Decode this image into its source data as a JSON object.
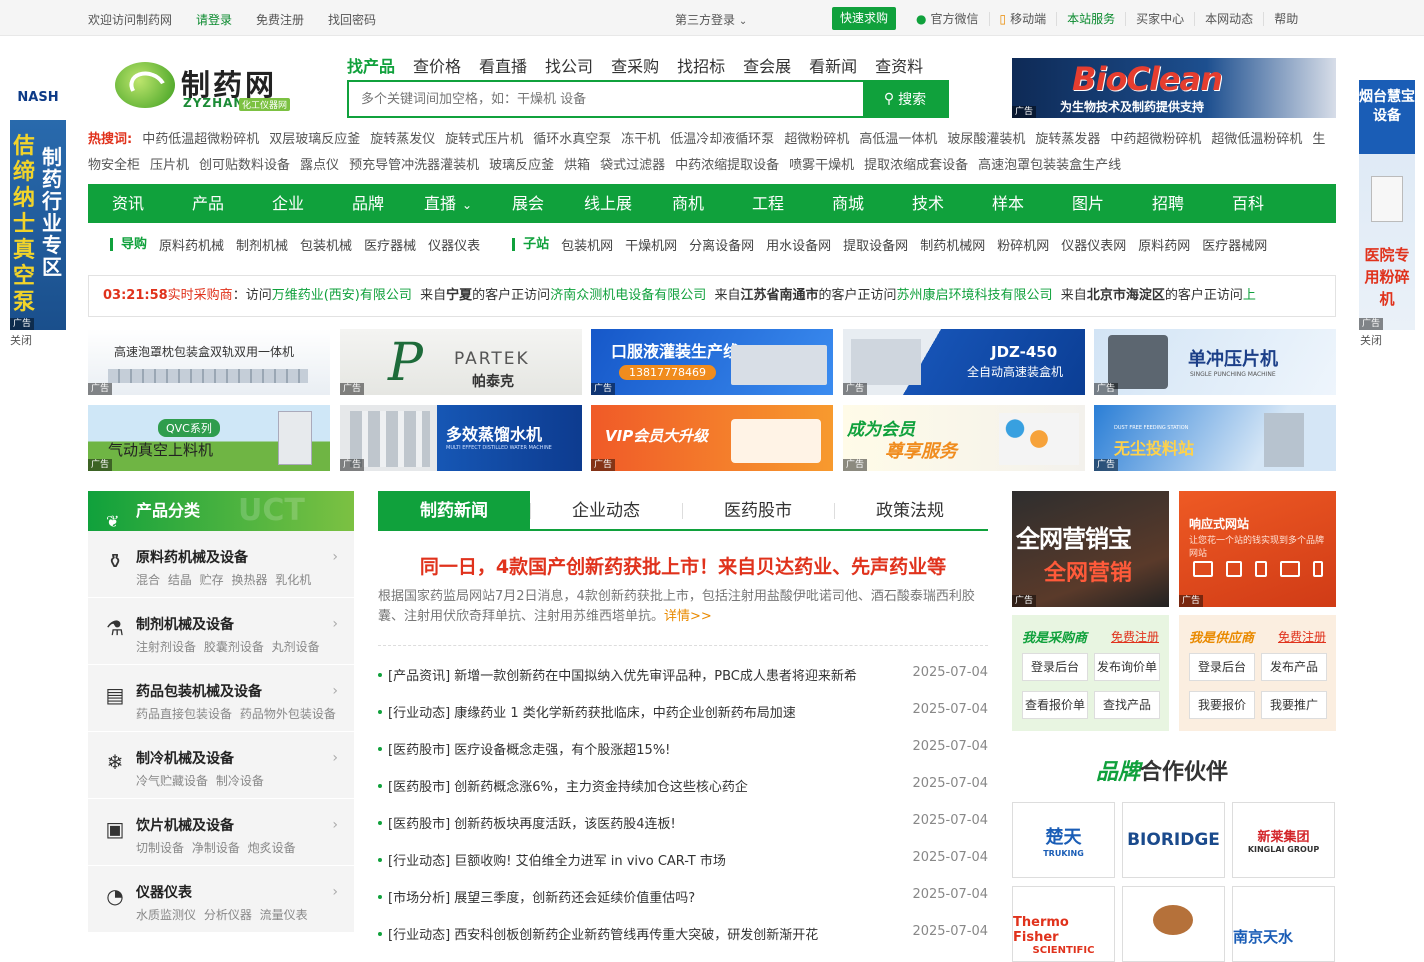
{
  "topbar": {
    "welcome": "欢迎访问制药网",
    "login": "请登录",
    "register": "免费注册",
    "find_password": "找回密码",
    "third_party_login": "第三方登录",
    "quick_purchase": "快速求购",
    "wechat": "官方微信",
    "mobile": "移动端",
    "site_service": "本站服务",
    "buyer_center": "买家中心",
    "site_news": "本网动态",
    "help": "帮助"
  },
  "logo": {
    "name": "制药网",
    "pinyin": "ZYZHAN",
    "tagline": "化工仪器网"
  },
  "search": {
    "tabs": [
      "找产品",
      "查价格",
      "看直播",
      "找公司",
      "查采购",
      "找招标",
      "查会展",
      "看新闻",
      "查资料"
    ],
    "active_tab": 0,
    "placeholder": "多个关键词间加空格，如：干燥机 设备",
    "button": "搜索"
  },
  "top_ad": {
    "brand": "BioClean",
    "text": "为生物技术及制药提供支持",
    "tag": "广告"
  },
  "hotwords": {
    "label": "热搜词:",
    "items": [
      "中药低温超微粉碎机",
      "双层玻璃反应釜",
      "旋转蒸发仪",
      "旋转式压片机",
      "循环水真空泵",
      "冻干机",
      "低温冷却液循环泵",
      "超微粉碎机",
      "高低温一体机",
      "玻尿酸灌装机",
      "旋转蒸发器",
      "中药超微粉碎机",
      "超微低温粉碎机",
      "生物安全柜",
      "压片机",
      "创可贴数料设备",
      "露点仪",
      "预充导管冲洗器灌装机",
      "玻璃反应釜",
      "烘箱",
      "袋式过滤器",
      "中药浓缩提取设备",
      "喷雾干燥机",
      "提取浓缩成套设备",
      "高速泡罩包装装盒生产线"
    ]
  },
  "mainnav": [
    "资讯",
    "产品",
    "企业",
    "品牌",
    "直播",
    "展会",
    "线上展",
    "商机",
    "工程",
    "商城",
    "技术",
    "样本",
    "图片",
    "招聘",
    "百科"
  ],
  "subnav": {
    "guide_label": "导购",
    "guide_items": [
      "原料药机械",
      "制剂机械",
      "包装机械",
      "医疗器械",
      "仪器仪表"
    ],
    "sub_label": "子站",
    "sub_items": [
      "包装机网",
      "干燥机网",
      "分离设备网",
      "用水设备网",
      "提取设备网",
      "制药机械网",
      "粉碎机网",
      "仪器仪表网",
      "原料药网",
      "医疗器械网"
    ]
  },
  "ticker": {
    "time": "03:21:58",
    "label": "实时采购商",
    "p1": "访问",
    "c1": "万维药业(西安)有限公司",
    "p2": "来自",
    "loc2": "宁夏",
    "p3": "的客户正访问",
    "c2": "济南众测机电设备有限公司",
    "p4": "来自",
    "loc3": "江苏省南通市",
    "p5": "的客户正访问",
    "c3": "苏州康启环境科技有限公司",
    "p6": "来自",
    "loc4": "北京市海淀区",
    "p7": "的客户正访问",
    "c4": "上"
  },
  "banners": [
    {
      "text": "高速泡罩枕包装盒双轨双用一体机",
      "tag": "广告"
    },
    {
      "text": "PARTEK",
      "sub": "帕泰克",
      "tag": "广告"
    },
    {
      "text": "口服液灌装生产线",
      "sub": "13817778469",
      "tag": "广告"
    },
    {
      "text": "JDZ-450",
      "sub": "全自动高速装盒机",
      "tag": "广告"
    },
    {
      "text": "单冲压片机",
      "sub": "SINGLE PUNCHING MACHINE",
      "tag": "广告"
    },
    {
      "text": "QVC系列",
      "sub": "气动真空上料机",
      "tag": "广告"
    },
    {
      "text": "多效蒸馏水机",
      "sub": "MULTI EFFECT DISTILLED WATER MACHINE",
      "tag": "广告"
    },
    {
      "text": "VIP会员大升级",
      "tag": "广告"
    },
    {
      "text": "成为会员",
      "sub": "尊享服务",
      "tag": "广告"
    },
    {
      "text": "无尘投料站",
      "sub": "DUST FREE FEEDING STATION",
      "tag": "广告"
    }
  ],
  "left_ad": {
    "brand": "NASH",
    "col1": "佶缔纳士真空泵",
    "col2": "制药行业专区",
    "tag": "广告",
    "close": "关闭"
  },
  "right_ad": {
    "top": "烟台慧宝设备",
    "bottom": "医院专用粉碎机",
    "tag": "广告",
    "close": "关闭"
  },
  "categories": {
    "title": "产品分类",
    "ghost": "UCT",
    "items": [
      {
        "name": "原料药机械及设备",
        "sub": "混合 结晶 贮存 换热器 乳化机",
        "icon": "bottle-icon"
      },
      {
        "name": "制剂机械及设备",
        "sub": "注射剂设备 胶囊剂设备 丸剂设备",
        "icon": "flask-icon"
      },
      {
        "name": "药品包装机械及设备",
        "sub": "药品直接包装设备 药品物外包装设备",
        "icon": "package-icon"
      },
      {
        "name": "制冷机械及设备",
        "sub": "冷气贮藏设备 制冷设备",
        "icon": "snowflake-icon"
      },
      {
        "name": "饮片机械及设备",
        "sub": "切制设备 净制设备 炮炙设备",
        "icon": "machine-icon"
      },
      {
        "name": "仪器仪表",
        "sub": "水质监测仪 分析仪器 流量仪表",
        "icon": "gauge-icon"
      }
    ]
  },
  "news": {
    "tabs": [
      "制药新闻",
      "企业动态",
      "医药股市",
      "政策法规"
    ],
    "headline": "同一日，4款国产创新药获批上市！来自贝达药业、先声药业等",
    "summary": "根据国家药监局网站7月2日消息，4款创新药获批上市，包括注射用盐酸伊吡诺司他、酒石酸泰瑞西利胶囊、注射用伏欣奇拜单抗、注射用苏维西塔单抗。",
    "more": "详情>>",
    "items": [
      {
        "title": "[产品资讯] 新增一款创新药在中国拟纳入优先审评品种，PBC成人患者将迎来新希",
        "date": "2025-07-04"
      },
      {
        "title": "[行业动态] 康缘药业 1 类化学新药获批临床，中药企业创新药布局加速",
        "date": "2025-07-04"
      },
      {
        "title": "[医药股市] 医疗设备概念走强，有个股涨超15%!",
        "date": "2025-07-04"
      },
      {
        "title": "[医药股市] 创新药概念涨6%，主力资金持续加仓这些核心药企",
        "date": "2025-07-04"
      },
      {
        "title": "[医药股市] 创新药板块再度活跃，该医药股4连板!",
        "date": "2025-07-04"
      },
      {
        "title": "[行业动态] 巨额收购! 艾伯维全力进军 in vivo CAR-T 市场",
        "date": "2025-07-04"
      },
      {
        "title": "[市场分析] 展望三季度，创新药还会延续价值重估吗?",
        "date": "2025-07-04"
      },
      {
        "title": "[行业动态] 西安科创板创新药企业新药管线再传重大突破，研发创新渐开花",
        "date": "2025-07-04"
      }
    ]
  },
  "right_ads": {
    "qwyx": {
      "line1": "全网营销宝",
      "line2": "全网营销",
      "tag": "广告"
    },
    "xyw": {
      "line1": "响应式网站",
      "line2": "让您花一个站的钱实现到多个品牌网站",
      "tag": "广告"
    }
  },
  "buyer_box": {
    "title": "我是采购商",
    "register": "免费注册",
    "buttons": [
      "登录后台",
      "发布询价单",
      "查看报价单",
      "查找产品"
    ]
  },
  "seller_box": {
    "title": "我是供应商",
    "register": "免费注册",
    "buttons": [
      "登录后台",
      "发布产品",
      "我要报价",
      "我要推广"
    ]
  },
  "brands": {
    "title_em": "品牌",
    "title": "合作伙伴",
    "items": [
      "楚天",
      "BIORIDGE",
      "新莱集团",
      "Thermo Fisher",
      "",
      "南京天水"
    ],
    "subs": [
      "TRUKING",
      "",
      "KINGLAI GROUP",
      "SCIENTIFIC",
      "",
      ""
    ]
  },
  "colors": {
    "primary": "#10a13c",
    "accent_red": "#e0321c",
    "orange": "#e98a00"
  }
}
